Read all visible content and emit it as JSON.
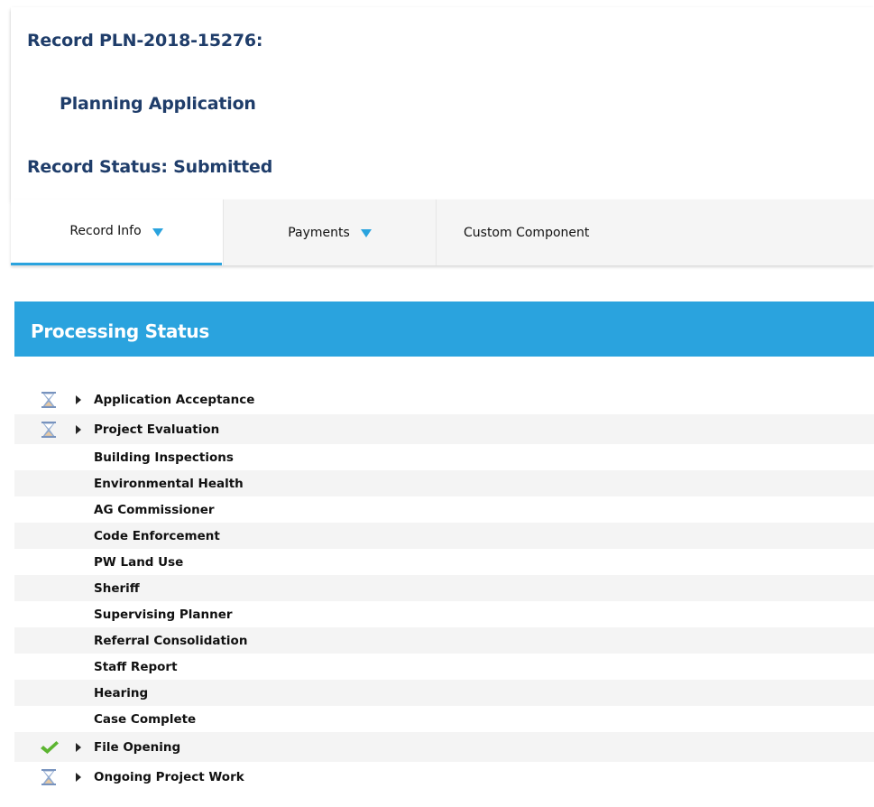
{
  "record": {
    "id_line": "Record PLN-2018-15276:",
    "type": "Planning Application",
    "status_line": "Record Status: Submitted"
  },
  "tabs": [
    {
      "label": "Record Info",
      "has_dropdown": true,
      "active": true
    },
    {
      "label": "Payments",
      "has_dropdown": true,
      "active": false
    },
    {
      "label": "Custom Component",
      "has_dropdown": false,
      "active": false
    }
  ],
  "processing_status": {
    "title": "Processing Status",
    "items": [
      {
        "label": "Application Acceptance",
        "icon": "hourglass-icon",
        "expandable": true
      },
      {
        "label": "Project Evaluation",
        "icon": "hourglass-icon",
        "expandable": true
      },
      {
        "label": "Building Inspections",
        "icon": null,
        "expandable": false
      },
      {
        "label": "Environmental Health",
        "icon": null,
        "expandable": false
      },
      {
        "label": "AG Commissioner",
        "icon": null,
        "expandable": false
      },
      {
        "label": "Code Enforcement",
        "icon": null,
        "expandable": false
      },
      {
        "label": "PW Land Use",
        "icon": null,
        "expandable": false
      },
      {
        "label": "Sheriff",
        "icon": null,
        "expandable": false
      },
      {
        "label": "Supervising Planner",
        "icon": null,
        "expandable": false
      },
      {
        "label": "Referral Consolidation",
        "icon": null,
        "expandable": false
      },
      {
        "label": "Staff Report",
        "icon": null,
        "expandable": false
      },
      {
        "label": "Hearing",
        "icon": null,
        "expandable": false
      },
      {
        "label": "Case Complete",
        "icon": null,
        "expandable": false
      },
      {
        "label": "File Opening",
        "icon": "checkmark-icon",
        "expandable": true
      },
      {
        "label": "Ongoing Project Work",
        "icon": "hourglass-icon",
        "expandable": true
      }
    ]
  },
  "colors": {
    "title_navy": "#1f3d6a",
    "accent_blue": "#2aa3de",
    "check_green": "#5cb531",
    "hourglass_blue": "#8fa9cf",
    "hourglass_sand": "#e9c9a0"
  }
}
